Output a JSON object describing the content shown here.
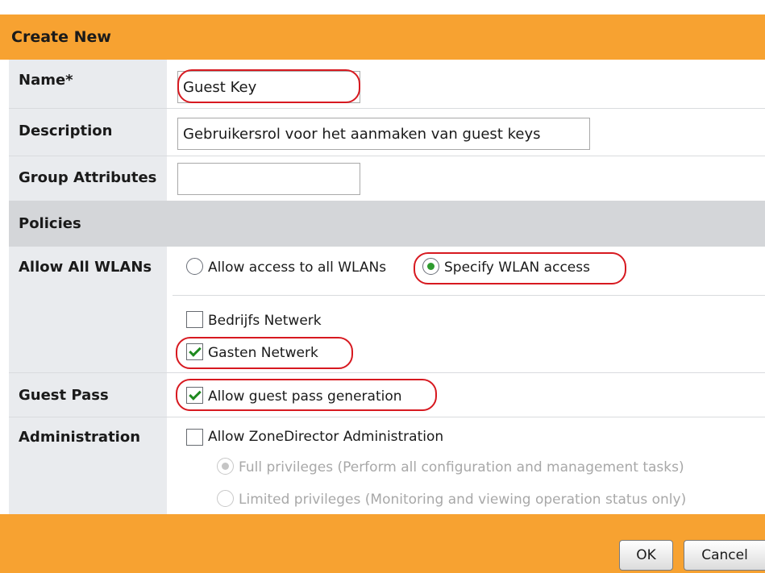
{
  "dialog": {
    "title": "Create New"
  },
  "fields": {
    "name": {
      "label": "Name*",
      "value": "Guest Key"
    },
    "description": {
      "label": "Description",
      "value": "Gebruikersrol voor het aanmaken van guest keys"
    },
    "group_attributes": {
      "label": "Group Attributes",
      "value": ""
    }
  },
  "policies": {
    "section_label": "Policies",
    "allow_all_wlans": {
      "label": "Allow All WLANs",
      "options": [
        {
          "label": "Allow access to all WLANs",
          "selected": false
        },
        {
          "label": "Specify WLAN access",
          "selected": true
        }
      ],
      "wlans": [
        {
          "label": "Bedrijfs Netwerk",
          "checked": false
        },
        {
          "label": "Gasten Netwerk",
          "checked": true
        }
      ]
    },
    "guest_pass": {
      "label": "Guest Pass",
      "option_label": "Allow guest pass generation",
      "checked": true
    },
    "administration": {
      "label": "Administration",
      "option_label": "Allow ZoneDirector Administration",
      "checked": false,
      "privileges": [
        {
          "label": "Full privileges (Perform all configuration and management tasks)",
          "selected": true,
          "enabled": false
        },
        {
          "label": "Limited privileges (Monitoring and viewing operation status only)",
          "selected": false,
          "enabled": false
        }
      ]
    }
  },
  "buttons": {
    "ok": "OK",
    "cancel": "Cancel"
  },
  "colors": {
    "header_bar": "#f7a231",
    "highlight_ring": "#d71920",
    "label_column": "#e9ebee"
  }
}
